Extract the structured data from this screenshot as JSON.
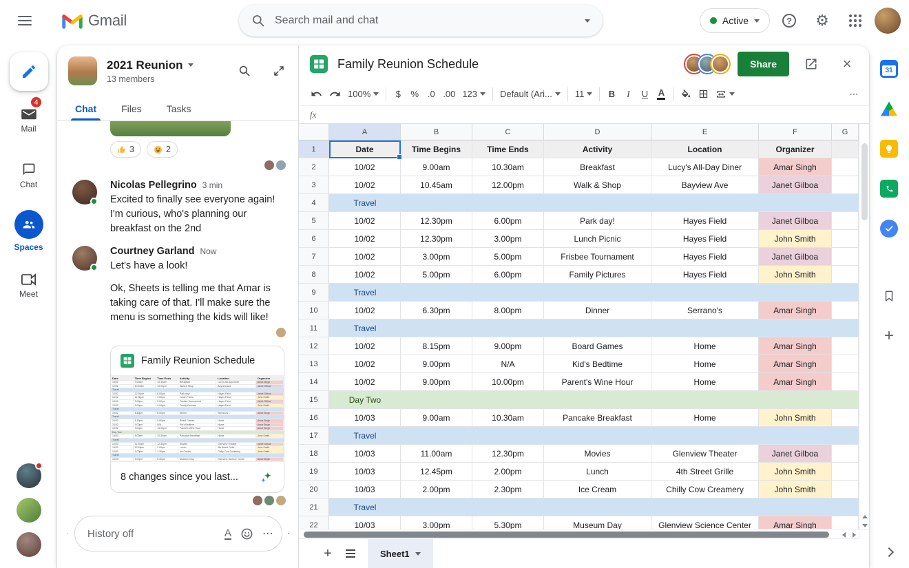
{
  "icons": {
    "settings": "⚙",
    "help": "?",
    "close": "×",
    "plus": "+",
    "more_horizontal": "⋯",
    "format_letter": "A"
  },
  "header": {
    "app_name": "Gmail",
    "search": {
      "placeholder": "Search mail and chat"
    },
    "status": {
      "label": "Active"
    }
  },
  "left_rail": {
    "items": [
      {
        "label": "Mail",
        "badge": "4"
      },
      {
        "label": "Chat"
      },
      {
        "label": "Spaces"
      },
      {
        "label": "Meet"
      }
    ]
  },
  "chat": {
    "space": {
      "name": "2021 Reunion",
      "members": "13 members"
    },
    "tabs": [
      {
        "label": "Chat"
      },
      {
        "label": "Files"
      },
      {
        "label": "Tasks"
      }
    ],
    "reactions": [
      {
        "icon": "thumbs-up",
        "count": "3"
      },
      {
        "icon": "smiley",
        "count": "2"
      }
    ],
    "messages": [
      {
        "author": "Nicolas Pellegrino",
        "time": "3 min",
        "paragraphs": [
          "Excited to finally see everyone again! I'm curious, who's planning our breakfast on the 2nd"
        ]
      },
      {
        "author": "Courtney Garland",
        "time": "Now",
        "paragraphs": [
          "Let's have a look!",
          "Ok, Sheets is telling me that Amar is taking care of that. I'll make sure the menu is something the kids will like!"
        ]
      }
    ],
    "file_card": {
      "title": "Family Reunion Schedule",
      "update_note": "8 changes since you last..."
    },
    "composer": {
      "placeholder": "History off"
    }
  },
  "sheets": {
    "title": "Family Reunion Schedule",
    "share_label": "Share",
    "formula_bar_label": "fx",
    "sheet_tab": "Sheet1",
    "toolbar": {
      "zoom": "100%",
      "currency": "$",
      "percent": "%",
      "decimal_decrease": ".0",
      "decimal_increase": ".00",
      "number_formats": "123",
      "font": "Default (Ari...",
      "font_size": "11",
      "bold": "B",
      "italic": "I",
      "underline": "U",
      "text_color": "A",
      "more": "⋯"
    },
    "columns": [
      "A",
      "B",
      "C",
      "D",
      "E",
      "F",
      "G"
    ],
    "table": {
      "headers": [
        "Date",
        "Time Begins",
        "Time Ends",
        "Activity",
        "Location",
        "Organizer"
      ],
      "rows": [
        {
          "type": "data",
          "cells": [
            "10/02",
            "9.00am",
            "10.30am",
            "Breakfast",
            "Lucy's All-Day Diner",
            "Amar Singh"
          ]
        },
        {
          "type": "data",
          "cells": [
            "10/02",
            "10.45am",
            "12.00pm",
            "Walk & Shop",
            "Bayview Ave",
            "Janet Gilboa"
          ]
        },
        {
          "type": "band",
          "label": "Travel"
        },
        {
          "type": "data",
          "cells": [
            "10/02",
            "12.30pm",
            "6.00pm",
            "Park day!",
            "Hayes Field",
            "Janet Gilboa"
          ]
        },
        {
          "type": "data",
          "cells": [
            "10/02",
            "12.30pm",
            "3.00pm",
            "Lunch Picnic",
            "Hayes Field",
            "John Smith"
          ]
        },
        {
          "type": "data",
          "cells": [
            "10/02",
            "3.00pm",
            "5.00pm",
            "Frisbee Tournament",
            "Hayes Field",
            "Janet Gilboa"
          ]
        },
        {
          "type": "data",
          "cells": [
            "10/02",
            "5.00pm",
            "6.00pm",
            "Family Pictures",
            "Hayes Field",
            "John Smith"
          ]
        },
        {
          "type": "band",
          "label": "Travel"
        },
        {
          "type": "data",
          "cells": [
            "10/02",
            "6.30pm",
            "8.00pm",
            "Dinner",
            "Serrano's",
            "Amar Singh"
          ]
        },
        {
          "type": "band",
          "label": "Travel"
        },
        {
          "type": "data",
          "cells": [
            "10/02",
            "8.15pm",
            "9.00pm",
            "Board Games",
            "Home",
            "Amar Singh"
          ]
        },
        {
          "type": "data",
          "cells": [
            "10/02",
            "9.00pm",
            "N/A",
            "Kid's Bedtime",
            "Home",
            "Amar Singh"
          ]
        },
        {
          "type": "data",
          "cells": [
            "10/02",
            "9.00pm",
            "10.00pm",
            "Parent's Wine Hour",
            "Home",
            "Amar Singh"
          ]
        },
        {
          "type": "band",
          "label": "Day Two"
        },
        {
          "type": "data",
          "cells": [
            "10/03",
            "9.00am",
            "10.30am",
            "Pancake Breakfast",
            "Home",
            "John Smith"
          ]
        },
        {
          "type": "band",
          "label": "Travel"
        },
        {
          "type": "data",
          "cells": [
            "10/03",
            "11.00am",
            "12.30pm",
            "Movies",
            "Glenview Theater",
            "Janet Gilboa"
          ]
        },
        {
          "type": "data",
          "cells": [
            "10/03",
            "12.45pm",
            "2.00pm",
            "Lunch",
            "4th Street Grille",
            "John Smith"
          ]
        },
        {
          "type": "data",
          "cells": [
            "10/03",
            "2.00pm",
            "2.30pm",
            "Ice Cream",
            "Chilly Cow Creamery",
            "John Smith"
          ]
        },
        {
          "type": "band",
          "label": "Travel"
        },
        {
          "type": "data",
          "cells": [
            "10/03",
            "3.00pm",
            "5.30pm",
            "Museum Day",
            "Glenview Science Center",
            "Amar Singh"
          ]
        }
      ],
      "organizer_colors": {
        "Amar Singh": "#f4cccc",
        "Janet Gilboa": "#ead1dc",
        "John Smith": "#fff2cc"
      },
      "band_colors": {
        "Travel": "#cfe2f3",
        "Day Two": "#d9ead3"
      },
      "band_text_colors": {
        "Travel": "#1c4587",
        "Day Two": "#274e13"
      }
    }
  },
  "right_rail": {
    "calendar_day": "31"
  }
}
